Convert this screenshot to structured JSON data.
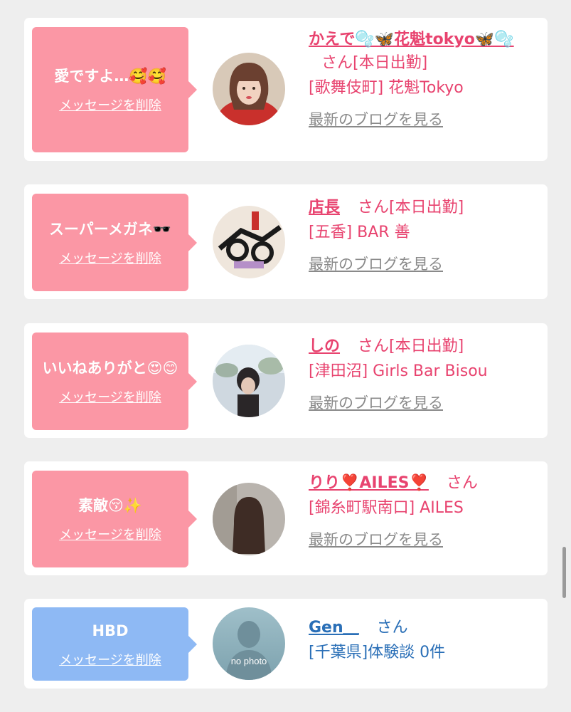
{
  "cards": [
    {
      "message": "愛ですよ…🥰🥰",
      "delete_label": "メッセージを削除",
      "name": "かえで🫧🦋花魁tokyo🦋🫧",
      "honorific": "さん",
      "work_status": "[本日出勤]",
      "shop": "[歌舞伎町] 花魁Tokyo",
      "blog_link": "最新のブログを見る",
      "bubble_color": "#fb97a5"
    },
    {
      "message": "スーパーメガネ🕶️",
      "delete_label": "メッセージを削除",
      "name": "店長",
      "honorific": "さん",
      "work_status": "[本日出勤]",
      "shop": "[五香] BAR 善",
      "blog_link": "最新のブログを見る",
      "bubble_color": "#fb97a5"
    },
    {
      "message": "いいねありがと😍😊",
      "delete_label": "メッセージを削除",
      "name": "しの",
      "honorific": "さん",
      "work_status": "[本日出勤]",
      "shop": "[津田沼] Girls Bar Bisou",
      "blog_link": "最新のブログを見る",
      "bubble_color": "#fb97a5"
    },
    {
      "message": "素敵😚✨",
      "delete_label": "メッセージを削除",
      "name": "りり❣️AILES❣️",
      "honorific": "さん",
      "shop": "[錦糸町駅南口] AILES",
      "blog_link": "最新のブログを見る",
      "bubble_color": "#fb97a5"
    },
    {
      "message": "HBD",
      "delete_label": "メッセージを削除",
      "name": "Gen＿",
      "honorific": "さん",
      "shop": "[千葉県]体験談 0件",
      "avatar_text": "no photo",
      "bubble_color": "#8eb9f4"
    }
  ],
  "colors": {
    "accent_pink": "#e8436f",
    "link_blue": "#2a6fb7",
    "background": "#eeeeee"
  }
}
